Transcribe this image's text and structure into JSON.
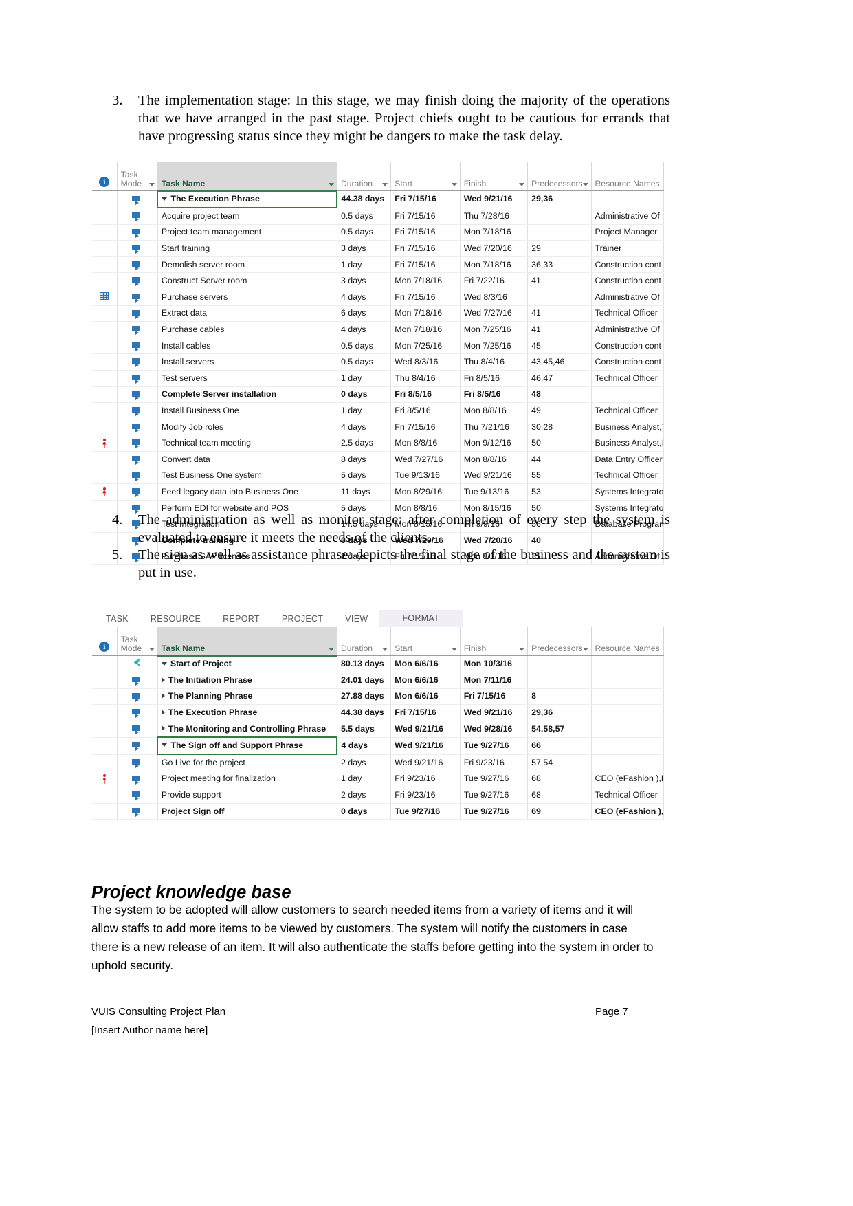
{
  "body": {
    "list_items": [
      {
        "number": "3.",
        "text": "The implementation stage: In this stage, we may finish doing the majority of the operations that we have arranged in the past stage. Project chiefs ought to be cautious for errands that have progressing status since they might be dangers to make the task delay."
      },
      {
        "number": "4.",
        "text": "The administration as well as monitor stage: after completion of every step the system is evaluated to ensure it meets the needs of the clients."
      },
      {
        "number": "5.",
        "text": "The sign as well as assistance phrase: depicts the final stage of the business and the system is put in use."
      }
    ],
    "kb_heading": "Project knowledge base",
    "kb_paragraph": "The system to be adopted will allow customers to search needed items from a variety of items and it will allow staffs to add more items to be viewed by customers. The system will notify the customers in case there is a new release of an item. It will also authenticate the staffs before getting into the system in order to uphold security."
  },
  "footer": {
    "left": "VUIS Consulting Project Plan",
    "right": "Page 7",
    "author": "[Insert Author name here]"
  },
  "colors": {
    "project_green": "#3c7d4e",
    "task_name_header_bg": "#d9d9d9",
    "auto_schedule_blue": "#2e75b6",
    "alert_red": "#e01b24",
    "info_blue": "#1f6fb2",
    "ribbon_active_bg": "#f1eef5"
  },
  "table1": {
    "columns": {
      "info": "",
      "mode_line1": "Task",
      "mode_line2": "Mode",
      "name": "Task Name",
      "duration": "Duration",
      "start": "Start",
      "finish": "Finish",
      "predecessors": "Predecessors",
      "resources": "Resource Names"
    },
    "rows": [
      {
        "indicator": "",
        "mode": "auto-schedule-icon",
        "indent": 1,
        "expander": "collapse",
        "name": "The Execution Phrase",
        "duration": "44.38 days",
        "start": "Fri 7/15/16",
        "finish": "Wed 9/21/16",
        "predecessors": "29,36",
        "resources": "",
        "summary": true,
        "selected": true
      },
      {
        "indicator": "",
        "mode": "auto-schedule-icon",
        "indent": 3,
        "expander": "",
        "name": "Acquire project team",
        "duration": "0.5 days",
        "start": "Fri 7/15/16",
        "finish": "Thu 7/28/16",
        "predecessors": "",
        "resources": "Administrative Of",
        "summary": false,
        "selected": false
      },
      {
        "indicator": "",
        "mode": "auto-schedule-icon",
        "indent": 3,
        "expander": "",
        "name": "Project team management",
        "duration": "0.5 days",
        "start": "Fri 7/15/16",
        "finish": "Mon 7/18/16",
        "predecessors": "",
        "resources": "Project Manager",
        "summary": false,
        "selected": false
      },
      {
        "indicator": "",
        "mode": "auto-schedule-icon",
        "indent": 3,
        "expander": "",
        "name": "Start training",
        "duration": "3 days",
        "start": "Fri 7/15/16",
        "finish": "Wed 7/20/16",
        "predecessors": "29",
        "resources": "Trainer",
        "summary": false,
        "selected": false
      },
      {
        "indicator": "",
        "mode": "auto-schedule-icon",
        "indent": 3,
        "expander": "",
        "name": "Demolish server room",
        "duration": "1 day",
        "start": "Fri 7/15/16",
        "finish": "Mon 7/18/16",
        "predecessors": "36,33",
        "resources": "Construction cont",
        "summary": false,
        "selected": false
      },
      {
        "indicator": "",
        "mode": "auto-schedule-icon",
        "indent": 3,
        "expander": "",
        "name": "Construct Server room",
        "duration": "3 days",
        "start": "Mon 7/18/16",
        "finish": "Fri 7/22/16",
        "predecessors": "41",
        "resources": "Construction cont",
        "summary": false,
        "selected": false
      },
      {
        "indicator": "grid-icon",
        "mode": "auto-schedule-icon",
        "indent": 3,
        "expander": "",
        "name": "Purchase servers",
        "duration": "4 days",
        "start": "Fri 7/15/16",
        "finish": "Wed 8/3/16",
        "predecessors": "",
        "resources": "Administrative Of",
        "summary": false,
        "selected": false
      },
      {
        "indicator": "",
        "mode": "auto-schedule-icon",
        "indent": 3,
        "expander": "",
        "name": "Extract data",
        "duration": "6 days",
        "start": "Mon 7/18/16",
        "finish": "Wed 7/27/16",
        "predecessors": "41",
        "resources": "Technical Officer",
        "summary": false,
        "selected": false
      },
      {
        "indicator": "",
        "mode": "auto-schedule-icon",
        "indent": 3,
        "expander": "",
        "name": "Purchase cables",
        "duration": "4 days",
        "start": "Mon 7/18/16",
        "finish": "Mon 7/25/16",
        "predecessors": "41",
        "resources": "Administrative Of",
        "summary": false,
        "selected": false
      },
      {
        "indicator": "",
        "mode": "auto-schedule-icon",
        "indent": 3,
        "expander": "",
        "name": "Install cables",
        "duration": "0.5 days",
        "start": "Mon 7/25/16",
        "finish": "Mon 7/25/16",
        "predecessors": "45",
        "resources": "Construction cont",
        "summary": false,
        "selected": false
      },
      {
        "indicator": "",
        "mode": "auto-schedule-icon",
        "indent": 3,
        "expander": "",
        "name": "Install servers",
        "duration": "0.5 days",
        "start": "Wed 8/3/16",
        "finish": "Thu 8/4/16",
        "predecessors": "43,45,46",
        "resources": "Construction cont",
        "summary": false,
        "selected": false
      },
      {
        "indicator": "",
        "mode": "auto-schedule-icon",
        "indent": 3,
        "expander": "",
        "name": "Test servers",
        "duration": "1 day",
        "start": "Thu 8/4/16",
        "finish": "Fri 8/5/16",
        "predecessors": "46,47",
        "resources": "Technical Officer",
        "summary": false,
        "selected": false
      },
      {
        "indicator": "",
        "mode": "auto-schedule-icon",
        "indent": 3,
        "expander": "",
        "name": "Complete Server installation",
        "duration": "0 days",
        "start": "Fri 8/5/16",
        "finish": "Fri 8/5/16",
        "predecessors": "48",
        "resources": "",
        "summary": true,
        "selected": false
      },
      {
        "indicator": "",
        "mode": "auto-schedule-icon",
        "indent": 3,
        "expander": "",
        "name": "Install Business One",
        "duration": "1 day",
        "start": "Fri 8/5/16",
        "finish": "Mon 8/8/16",
        "predecessors": "49",
        "resources": "Technical Officer",
        "summary": false,
        "selected": false
      },
      {
        "indicator": "",
        "mode": "auto-schedule-icon",
        "indent": 3,
        "expander": "",
        "name": "Modify Job roles",
        "duration": "4 days",
        "start": "Fri 7/15/16",
        "finish": "Thu 7/21/16",
        "predecessors": "30,28",
        "resources": "Business Analyst,T",
        "summary": false,
        "selected": false
      },
      {
        "indicator": "person-icon",
        "mode": "auto-schedule-icon",
        "indent": 3,
        "expander": "",
        "name": "Technical team meeting",
        "duration": "2.5 days",
        "start": "Mon 8/8/16",
        "finish": "Mon 9/12/16",
        "predecessors": "50",
        "resources": "Business Analyst,I",
        "summary": false,
        "selected": false
      },
      {
        "indicator": "",
        "mode": "auto-schedule-icon",
        "indent": 3,
        "expander": "",
        "name": "Convert data",
        "duration": "8 days",
        "start": "Wed 7/27/16",
        "finish": "Mon 8/8/16",
        "predecessors": "44",
        "resources": "Data Entry Officer",
        "summary": false,
        "selected": false
      },
      {
        "indicator": "",
        "mode": "auto-schedule-icon",
        "indent": 3,
        "expander": "",
        "name": "Test Business One system",
        "duration": "5 days",
        "start": "Tue 9/13/16",
        "finish": "Wed 9/21/16",
        "predecessors": "55",
        "resources": "Technical Officer",
        "summary": false,
        "selected": false
      },
      {
        "indicator": "person-icon",
        "mode": "auto-schedule-icon",
        "indent": 3,
        "expander": "",
        "name": "Feed legacy data into Business One",
        "duration": "11 days",
        "start": "Mon 8/29/16",
        "finish": "Tue 9/13/16",
        "predecessors": "53",
        "resources": "Systems Integrato",
        "summary": false,
        "selected": false
      },
      {
        "indicator": "",
        "mode": "auto-schedule-icon",
        "indent": 3,
        "expander": "",
        "name": "Perform EDI for website and POS",
        "duration": "5 days",
        "start": "Mon 8/8/16",
        "finish": "Mon 8/15/16",
        "predecessors": "50",
        "resources": "Systems Integrato",
        "summary": false,
        "selected": false
      },
      {
        "indicator": "",
        "mode": "auto-schedule-icon",
        "indent": 3,
        "expander": "",
        "name": "Test Integration",
        "duration": "14.5 days",
        "start": "Mon 8/15/16",
        "finish": "Fri 9/9/16",
        "predecessors": "56",
        "resources": "Database Program",
        "summary": false,
        "selected": false
      },
      {
        "indicator": "",
        "mode": "auto-schedule-icon",
        "indent": 3,
        "expander": "",
        "name": "Complete training",
        "duration": "0 days",
        "start": "Wed 7/20/16",
        "finish": "Wed 7/20/16",
        "predecessors": "40",
        "resources": "",
        "summary": true,
        "selected": false
      },
      {
        "indicator": "",
        "mode": "auto-schedule-icon",
        "indent": 3,
        "expander": "",
        "name": "Purchase SAP licenses",
        "duration": "2 days",
        "start": "Fri 7/15/16",
        "finish": "Mon 8/1/16",
        "predecessors": "31",
        "resources": "Administrative Of",
        "summary": false,
        "selected": false
      }
    ]
  },
  "table2": {
    "ribbon_tabs": [
      {
        "label": "TASK",
        "active": false
      },
      {
        "label": "RESOURCE",
        "active": false
      },
      {
        "label": "REPORT",
        "active": false
      },
      {
        "label": "PROJECT",
        "active": false
      },
      {
        "label": "VIEW",
        "active": false
      },
      {
        "label": "FORMAT",
        "active": true
      }
    ],
    "columns": {
      "info": "",
      "mode_line1": "Task",
      "mode_line2": "Mode",
      "name": "Task Name",
      "duration": "Duration",
      "start": "Start",
      "finish": "Finish",
      "predecessors": "Predecessors",
      "resources": "Resource Names"
    },
    "rows": [
      {
        "indicator": "",
        "mode": "pin-icon",
        "indent": 1,
        "expander": "collapse",
        "name": "Start of Project",
        "duration": "80.13 days",
        "start": "Mon 6/6/16",
        "finish": "Mon 10/3/16",
        "predecessors": "",
        "resources": "",
        "summary": true,
        "selected": false
      },
      {
        "indicator": "",
        "mode": "auto-schedule-icon",
        "indent": 2,
        "expander": "expand",
        "name": "The Initiation Phrase",
        "duration": "24.01 days",
        "start": "Mon 6/6/16",
        "finish": "Mon 7/11/16",
        "predecessors": "",
        "resources": "",
        "summary": true,
        "selected": false
      },
      {
        "indicator": "",
        "mode": "auto-schedule-icon",
        "indent": 2,
        "expander": "expand",
        "name": "The Planning Phrase",
        "duration": "27.88 days",
        "start": "Mon 6/6/16",
        "finish": "Fri 7/15/16",
        "predecessors": "8",
        "resources": "",
        "summary": true,
        "selected": false
      },
      {
        "indicator": "",
        "mode": "auto-schedule-icon",
        "indent": 2,
        "expander": "expand",
        "name": "The Execution Phrase",
        "duration": "44.38 days",
        "start": "Fri 7/15/16",
        "finish": "Wed 9/21/16",
        "predecessors": "29,36",
        "resources": "",
        "summary": true,
        "selected": false
      },
      {
        "indicator": "",
        "mode": "auto-schedule-icon",
        "indent": 2,
        "expander": "expand",
        "name": "The Monitoring and Controlling Phrase",
        "duration": "5.5 days",
        "start": "Wed 9/21/16",
        "finish": "Wed 9/28/16",
        "predecessors": "54,58,57",
        "resources": "",
        "summary": true,
        "selected": false
      },
      {
        "indicator": "",
        "mode": "auto-schedule-icon",
        "indent": 2,
        "expander": "collapse",
        "name": "The Sign off and Support Phrase",
        "duration": "4 days",
        "start": "Wed 9/21/16",
        "finish": "Tue 9/27/16",
        "predecessors": "66",
        "resources": "",
        "summary": true,
        "selected": true
      },
      {
        "indicator": "",
        "mode": "auto-schedule-icon",
        "indent": 3,
        "expander": "",
        "name": "Go Live for the project",
        "duration": "2 days",
        "start": "Wed 9/21/16",
        "finish": "Fri 9/23/16",
        "predecessors": "57,54",
        "resources": "",
        "summary": false,
        "selected": false
      },
      {
        "indicator": "person-icon",
        "mode": "auto-schedule-icon",
        "indent": 3,
        "expander": "",
        "name": "Project meeting for finalization",
        "duration": "1 day",
        "start": "Fri 9/23/16",
        "finish": "Tue 9/27/16",
        "predecessors": "68",
        "resources": "CEO (eFashion ),P",
        "summary": false,
        "selected": false
      },
      {
        "indicator": "",
        "mode": "auto-schedule-icon",
        "indent": 3,
        "expander": "",
        "name": "Provide support",
        "duration": "2 days",
        "start": "Fri 9/23/16",
        "finish": "Tue 9/27/16",
        "predecessors": "68",
        "resources": "Technical Officer",
        "summary": false,
        "selected": false
      },
      {
        "indicator": "",
        "mode": "auto-schedule-icon",
        "indent": 3,
        "expander": "",
        "name": "Project Sign off",
        "duration": "0 days",
        "start": "Tue 9/27/16",
        "finish": "Tue 9/27/16",
        "predecessors": "69",
        "resources": "CEO (eFashion ),V",
        "summary": true,
        "selected": false
      }
    ]
  }
}
